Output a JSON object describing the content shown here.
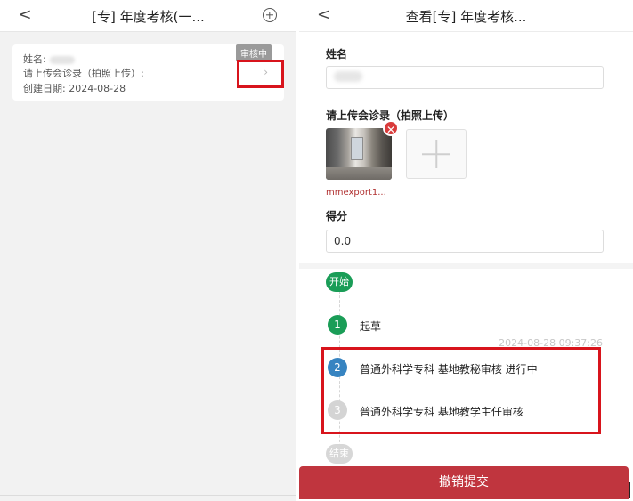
{
  "left": {
    "back_icon": "chevron-left-icon",
    "title": "[专] 年度考核(一...",
    "add_icon": "plus-circle-icon",
    "card": {
      "name_label": "姓名:",
      "upload_label": "请上传会诊录（拍照上传）:",
      "date_label": "创建日期:",
      "date_value": "2024-08-28",
      "status_badge": "审核中",
      "chevron": "›"
    }
  },
  "right": {
    "back_icon": "chevron-left-icon",
    "title": "查看[专] 年度考核...",
    "name_label": "姓名",
    "upload_label": "请上传会诊录（拍照上传）",
    "delete_glyph": "✕",
    "file_name": "mmexport1...",
    "score_label": "得分",
    "score_value": "0.0",
    "timeline": {
      "start_label": "开始",
      "steps": [
        {
          "num": "1",
          "text": "起草"
        },
        {
          "num": "2",
          "text": "普通外科学专科 基地教秘审核 进行中"
        },
        {
          "num": "3",
          "text": "普通外科学专科 基地教学主任审核"
        }
      ],
      "timestamp": "2024-08-28 09:37:26",
      "end_label": "结束"
    },
    "cancel_button": "撤销提交"
  },
  "colors": {
    "green": "#1a9d57",
    "blue": "#3784c1",
    "highlight_red": "#d8141c",
    "button_red": "#c0353e"
  }
}
